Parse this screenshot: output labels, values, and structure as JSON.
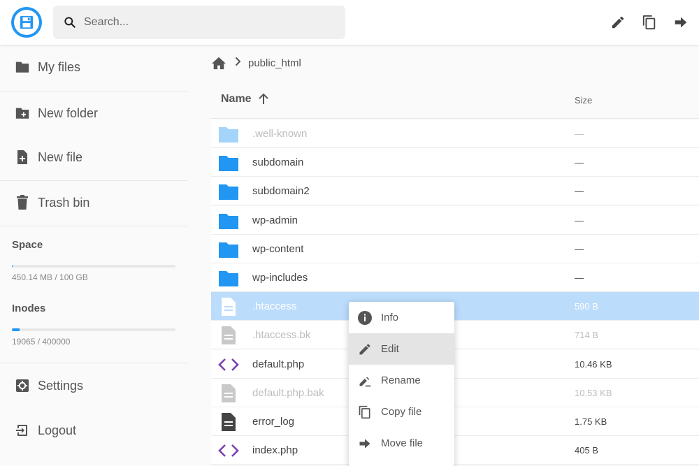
{
  "header": {
    "search_placeholder": "Search...",
    "actions": [
      {
        "name": "edit-icon"
      },
      {
        "name": "copy-icon"
      },
      {
        "name": "move-icon"
      }
    ]
  },
  "sidebar": {
    "items": [
      {
        "label": "My files",
        "icon": "folder-icon"
      },
      {
        "label": "New folder",
        "icon": "new-folder-icon"
      },
      {
        "label": "New file",
        "icon": "new-file-icon"
      },
      {
        "label": "Trash bin",
        "icon": "trash-icon"
      },
      {
        "label": "Settings",
        "icon": "settings-icon"
      },
      {
        "label": "Logout",
        "icon": "logout-icon"
      }
    ],
    "space": {
      "title": "Space",
      "text": "450.14 MB / 100 GB",
      "fraction": 0.0045
    },
    "inodes": {
      "title": "Inodes",
      "text": "19065 / 400000",
      "fraction": 0.048
    }
  },
  "breadcrumb": {
    "current": "public_html"
  },
  "listing": {
    "columns": {
      "name": "Name",
      "size": "Size"
    },
    "rows": [
      {
        "name": ".well-known",
        "size": "—",
        "type": "folder",
        "dim": true,
        "selected": false
      },
      {
        "name": "subdomain",
        "size": "—",
        "type": "folder",
        "dim": false,
        "selected": false
      },
      {
        "name": "subdomain2",
        "size": "—",
        "type": "folder",
        "dim": false,
        "selected": false
      },
      {
        "name": "wp-admin",
        "size": "—",
        "type": "folder",
        "dim": false,
        "selected": false
      },
      {
        "name": "wp-content",
        "size": "—",
        "type": "folder",
        "dim": false,
        "selected": false
      },
      {
        "name": "wp-includes",
        "size": "—",
        "type": "folder",
        "dim": false,
        "selected": false
      },
      {
        "name": ".htaccess",
        "size": "590 B",
        "type": "doc",
        "dim": false,
        "selected": true
      },
      {
        "name": ".htaccess.bk",
        "size": "714 B",
        "type": "doc",
        "dim": true,
        "selected": false
      },
      {
        "name": "default.php",
        "size": "10.46 KB",
        "type": "code",
        "dim": false,
        "selected": false
      },
      {
        "name": "default.php.bak",
        "size": "10.53 KB",
        "type": "doc",
        "dim": true,
        "selected": false
      },
      {
        "name": "error_log",
        "size": "1.75 KB",
        "type": "doc-dark",
        "dim": false,
        "selected": false
      },
      {
        "name": "index.php",
        "size": "405 B",
        "type": "code",
        "dim": false,
        "selected": false
      }
    ]
  },
  "context_menu": {
    "items": [
      {
        "label": "Info",
        "icon": "info-icon",
        "active": false
      },
      {
        "label": "Edit",
        "icon": "edit-icon",
        "active": true
      },
      {
        "label": "Rename",
        "icon": "rename-icon",
        "active": false
      },
      {
        "label": "Copy file",
        "icon": "copy-icon",
        "active": false
      },
      {
        "label": "Move file",
        "icon": "move-icon",
        "active": false
      }
    ]
  },
  "colors": {
    "accent": "#2196f3",
    "selected_row": "#bbdcfb",
    "code_icon": "#7b3fb5"
  }
}
